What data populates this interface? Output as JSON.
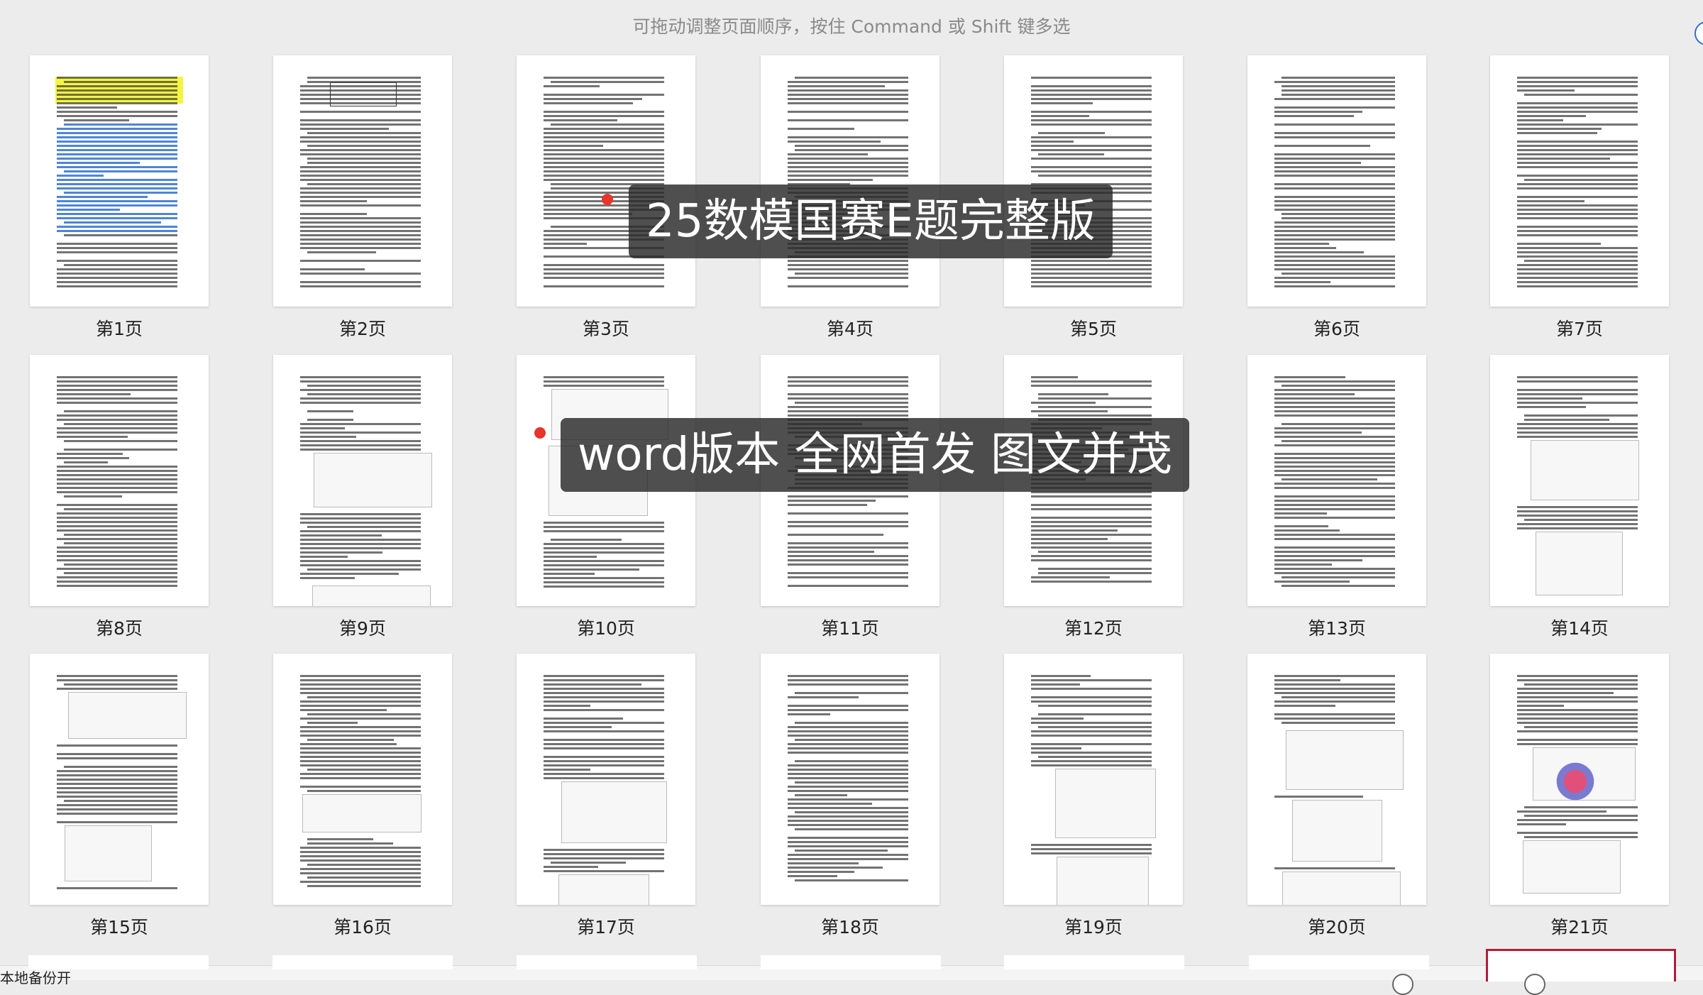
{
  "hint": "可拖动调整页面顺序，按住 Command 或 Shift 键多选",
  "overlay_title": "25数模国赛E题完整版",
  "overlay_subtitle": "word版本 全网首发 图文并茂",
  "pages": [
    {
      "label": "第1页"
    },
    {
      "label": "第2页"
    },
    {
      "label": "第3页"
    },
    {
      "label": "第4页"
    },
    {
      "label": "第5页"
    },
    {
      "label": "第6页"
    },
    {
      "label": "第7页"
    },
    {
      "label": "第8页"
    },
    {
      "label": "第9页"
    },
    {
      "label": "第10页"
    },
    {
      "label": "第11页"
    },
    {
      "label": "第12页"
    },
    {
      "label": "第13页"
    },
    {
      "label": "第14页"
    },
    {
      "label": "第15页"
    },
    {
      "label": "第16页"
    },
    {
      "label": "第17页"
    },
    {
      "label": "第18页"
    },
    {
      "label": "第19页"
    },
    {
      "label": "第20页"
    },
    {
      "label": "第21页"
    }
  ],
  "bottom_text": "本地备份开",
  "colors": {
    "accent_dot": "#e8342a",
    "selection": "#b21d3a",
    "highlight": "#f5f541"
  }
}
